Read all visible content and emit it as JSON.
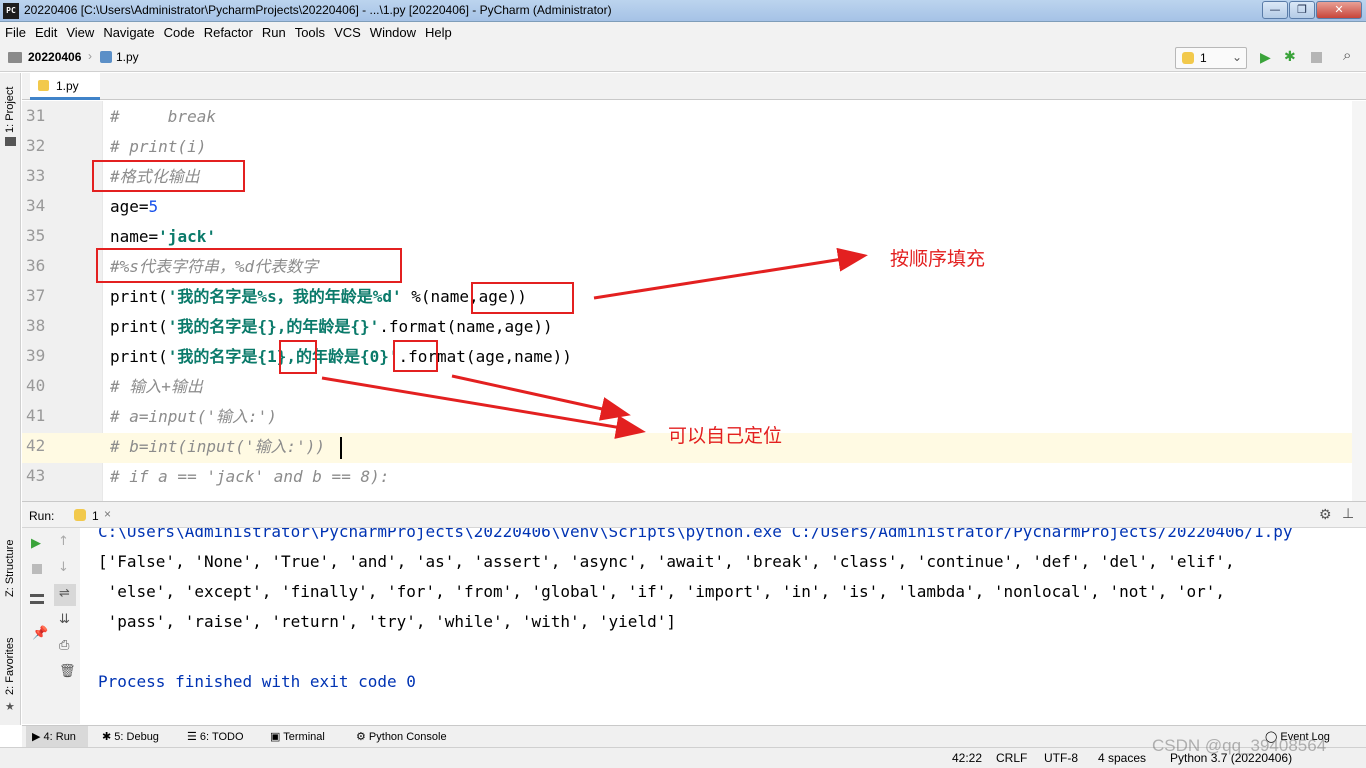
{
  "window": {
    "title": "20220406 [C:\\Users\\Administrator\\PycharmProjects\\20220406] - ...\\1.py [20220406] - PyCharm (Administrator)",
    "logo_text": "PC",
    "minimize": "—",
    "maximize": "❐",
    "close": "✕"
  },
  "menu": [
    "File",
    "Edit",
    "View",
    "Navigate",
    "Code",
    "Refactor",
    "Run",
    "Tools",
    "VCS",
    "Window",
    "Help"
  ],
  "nav": {
    "project": "20220406",
    "file": "1.py",
    "run_config": "1"
  },
  "left_strip": {
    "project": "1: Project",
    "structure": "Z: Structure",
    "favorites": "2: Favorites"
  },
  "editor": {
    "tab_label": "1.py",
    "lines": [
      {
        "num": "31",
        "text": "#     break",
        "kind": "cmt"
      },
      {
        "num": "32",
        "text": "# print(i)",
        "kind": "cmt"
      },
      {
        "num": "33",
        "text": "#格式化输出",
        "kind": "cmt"
      },
      {
        "num": "34",
        "pre": "age=",
        "val": "5",
        "kind": "num"
      },
      {
        "num": "35",
        "pre": "name=",
        "val": "'jack'",
        "kind": "str"
      },
      {
        "num": "36",
        "text": "#%s代表字符串，%d代表数字",
        "kind": "cmt"
      },
      {
        "num": "37",
        "pre": "print(",
        "val": "'我的名字是%s，我的年龄是%d'",
        "post": " %(name,age))",
        "kind": "str"
      },
      {
        "num": "38",
        "pre": "print(",
        "val": "'我的名字是{},的年龄是{}'",
        "post": ".format(name,age))",
        "kind": "str"
      },
      {
        "num": "39",
        "pre": "print(",
        "val": "'我的名字是{1},的年龄是{0}'",
        "post": ".format(age,name))",
        "kind": "str"
      },
      {
        "num": "40",
        "text": "# 输入+输出",
        "kind": "cmt"
      },
      {
        "num": "41",
        "text": "# a=input('输入:')",
        "kind": "cmt"
      },
      {
        "num": "42",
        "text": "# b=int(input('输入:'))",
        "kind": "cmt"
      },
      {
        "num": "43",
        "text": "# if a == 'jack' and b == 8):",
        "kind": "cmt"
      }
    ]
  },
  "run_panel": {
    "label": "Run:",
    "tab": "1",
    "output": [
      "C:\\Users\\Administrator\\PycharmProjects\\20220406\\venv\\Scripts\\python.exe C:/Users/Administrator/PycharmProjects/20220406/1.py",
      "['False', 'None', 'True', 'and', 'as', 'assert', 'async', 'await', 'break', 'class', 'continue', 'def', 'del', 'elif',",
      " 'else', 'except', 'finally', 'for', 'from', 'global', 'if', 'import', 'in', 'is', 'lambda', 'nonlocal', 'not', 'or',",
      " 'pass', 'raise', 'return', 'try', 'while', 'with', 'yield']",
      "",
      "Process finished with exit code 0"
    ]
  },
  "bottom_tabs": [
    "4: Run",
    "5: Debug",
    "6: TODO",
    "Terminal",
    "Python Console",
    "Event Log"
  ],
  "status": {
    "position": "42:22",
    "line_sep": "CRLF",
    "encoding": "UTF-8",
    "indent": "4 spaces",
    "interpreter": "Python 3.7 (20220406)",
    "watermark": "CSDN @qq_39408564"
  },
  "annotations": {
    "fill_in_order": "按顺序填充",
    "position_yourself": "可以自己定位"
  },
  "colors": {
    "annotation_red": "#e32020",
    "comment": "#8c8c8c",
    "string": "#0a7a6a",
    "number": "#1750eb",
    "output_blue": "#0033b3"
  }
}
